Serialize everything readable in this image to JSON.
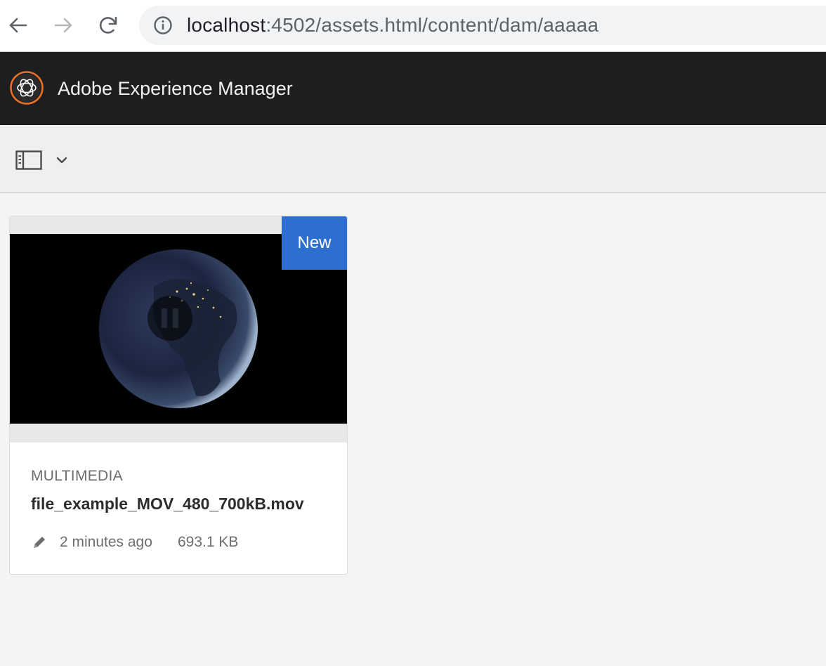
{
  "browser": {
    "url_host": "localhost",
    "url_rest": ":4502/assets.html/content/dam/aaaaa",
    "icons": [
      "back-arrow-icon",
      "forward-arrow-icon",
      "reload-icon",
      "info-icon"
    ]
  },
  "header": {
    "app_title": "Adobe Experience Manager",
    "logo_color": "#e8702a",
    "background": "#1e1e1e"
  },
  "toolbar": {
    "icons": [
      "rail-toggle-icon",
      "chevron-down-icon"
    ]
  },
  "asset_card": {
    "badge": "New",
    "badge_color": "#2d6fd1",
    "type": "MULTIMEDIA",
    "name": "file_example_MOV_480_700kB.mov",
    "modified": "2 minutes ago",
    "size": "693.1 KB",
    "video_state": "paused",
    "icons": [
      "pause-icon",
      "pencil-icon"
    ]
  }
}
